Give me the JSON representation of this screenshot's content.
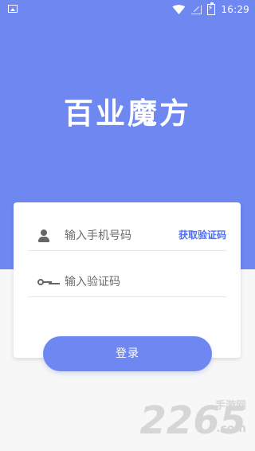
{
  "status_bar": {
    "time": "16:29"
  },
  "app": {
    "title": "百业魔方"
  },
  "login_form": {
    "phone_placeholder": "输入手机号码",
    "get_code_label": "获取验证码",
    "code_placeholder": "输入验证码",
    "submit_label": "登录"
  },
  "watermark": {
    "brand_number": "2265",
    "brand_text": "手游网",
    "domain": ".com"
  },
  "icons": {
    "gallery": "image-icon",
    "wifi": "wifi-icon",
    "signal": "signal-icon",
    "battery": "battery-icon",
    "user": "user-icon",
    "key": "key-icon"
  },
  "colors": {
    "primary": "#6f87f1",
    "accent_text": "#4c6ef5",
    "background": "#f7f7f8"
  }
}
